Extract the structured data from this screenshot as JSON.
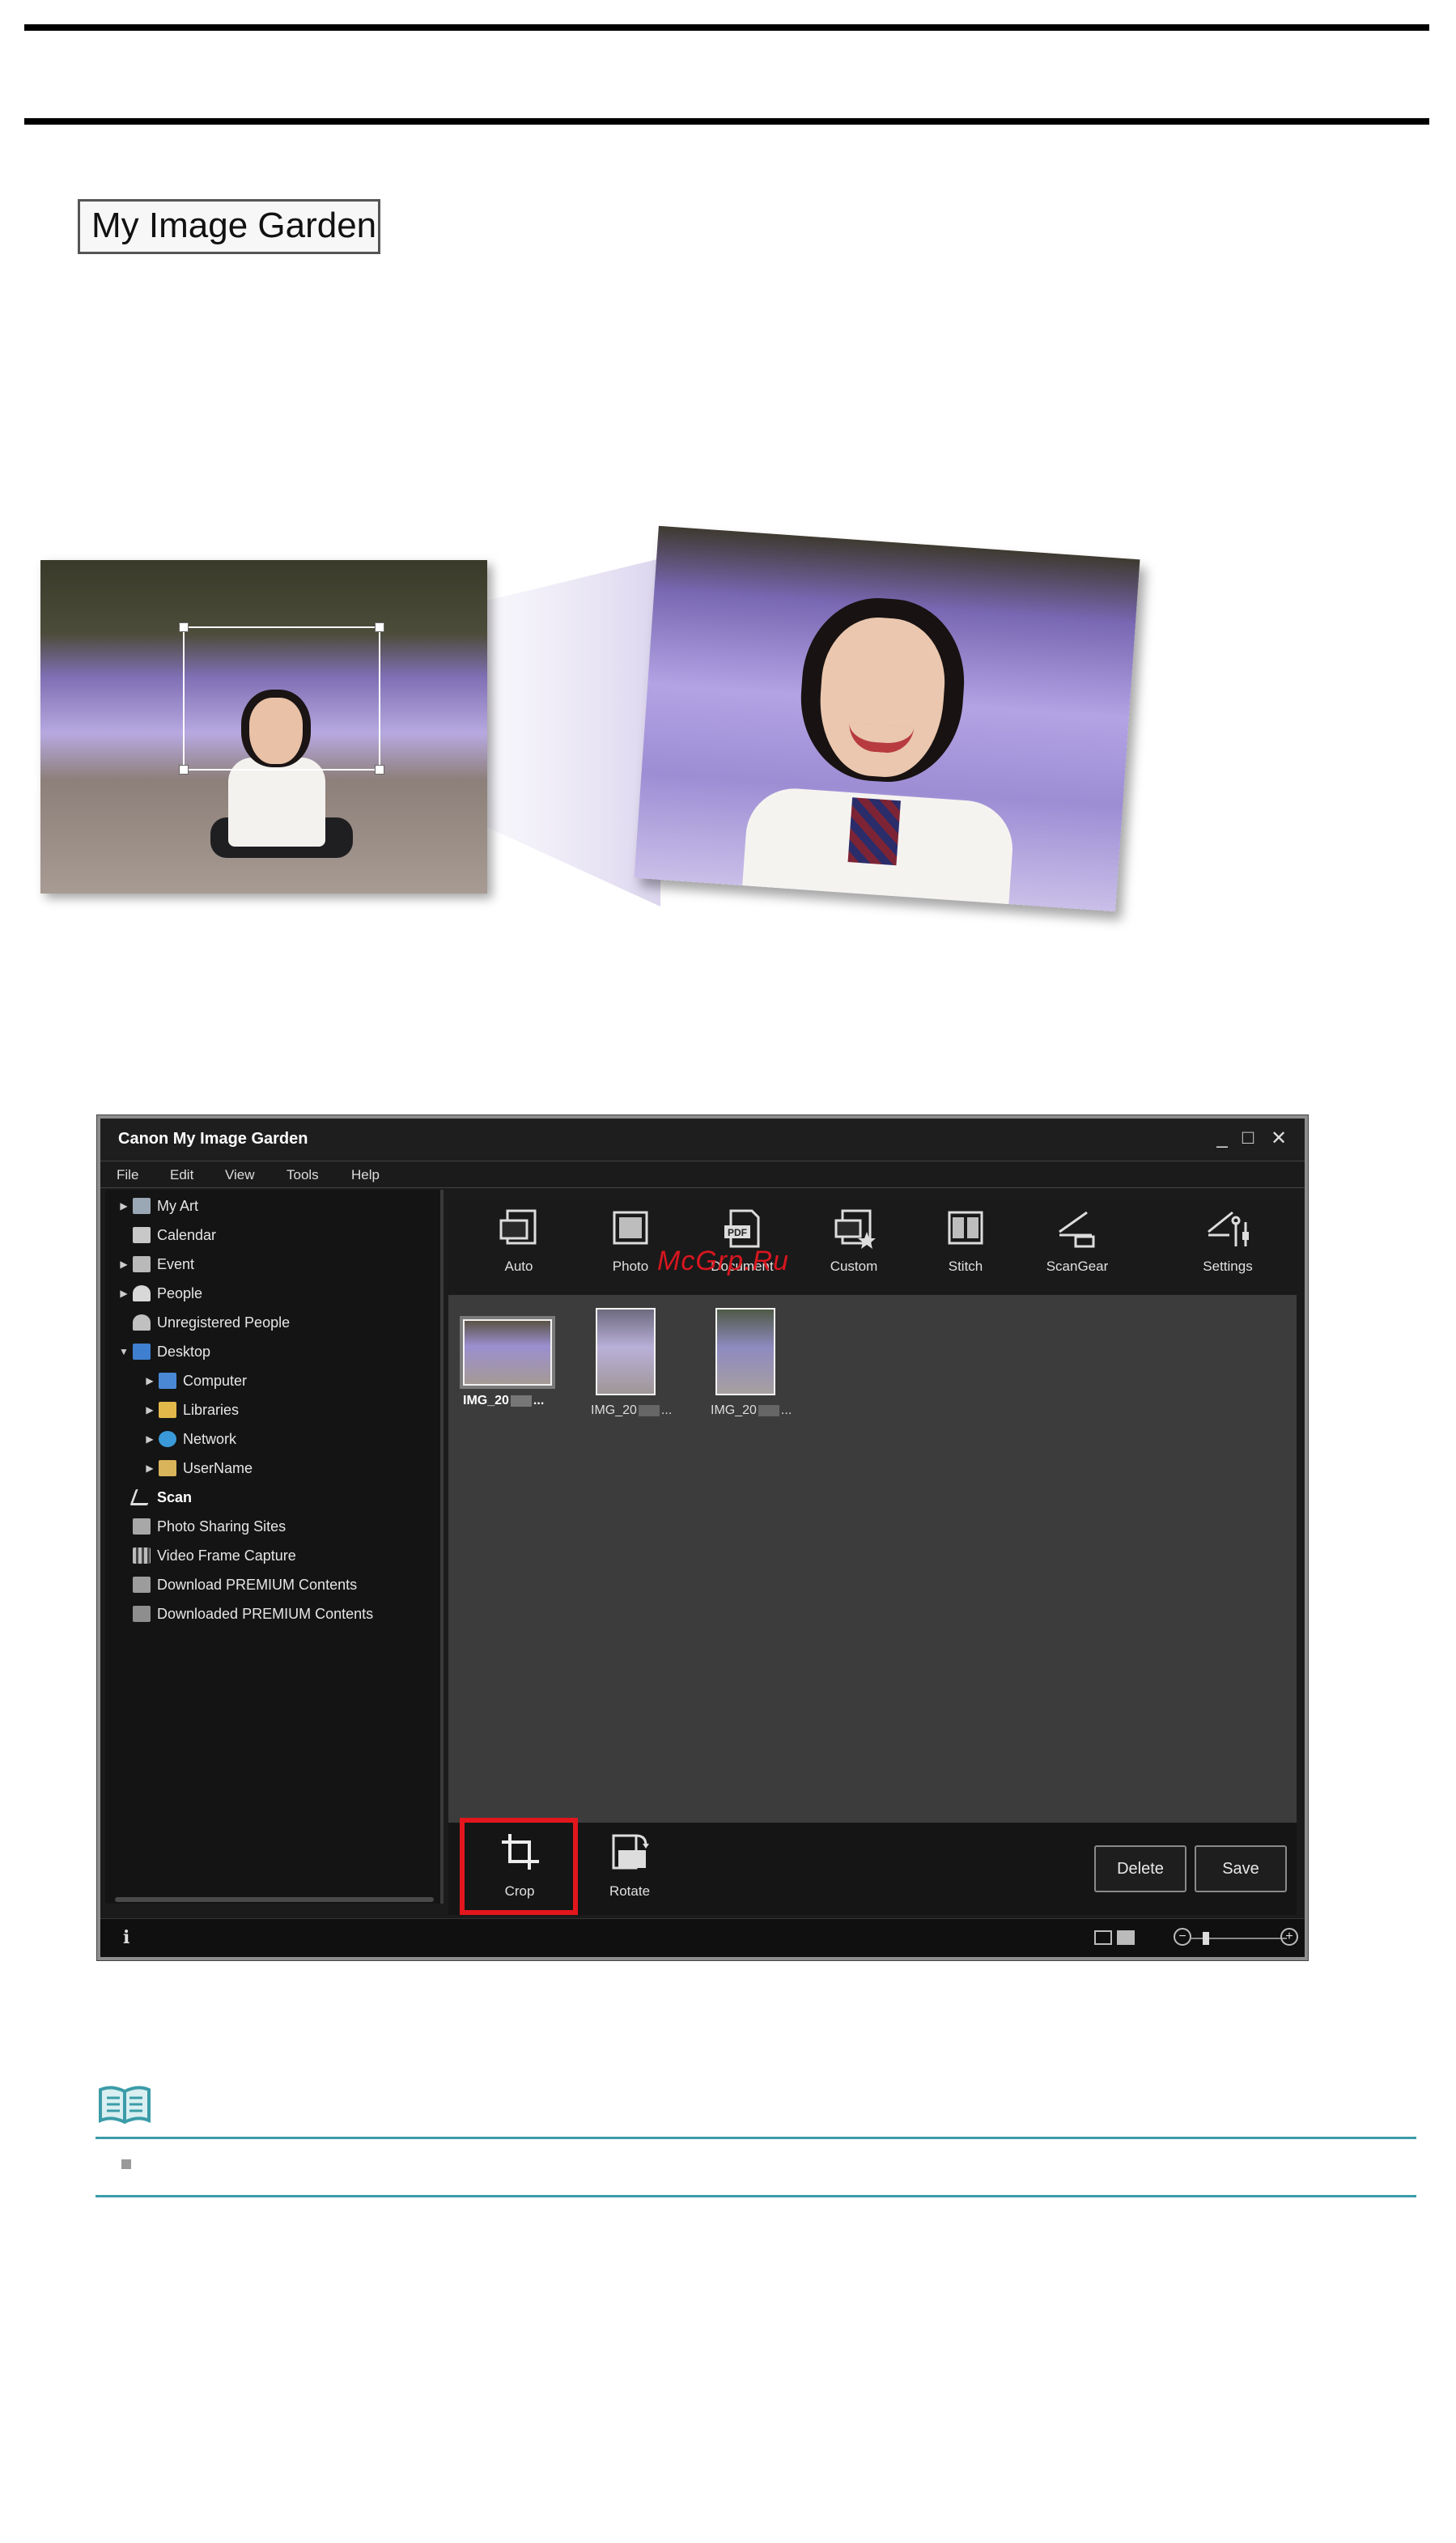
{
  "header": {
    "title_box": "My Image Garden"
  },
  "window": {
    "title": "Canon My Image Garden",
    "controls": {
      "minimize": "_",
      "maximize": "□",
      "close": "✕"
    },
    "menu": [
      "File",
      "Edit",
      "View",
      "Tools",
      "Help"
    ],
    "sidebar": [
      {
        "label": "My Art",
        "icon": "my-art-icon",
        "level": 0,
        "arrow": "▶"
      },
      {
        "label": "Calendar",
        "icon": "calendar-icon",
        "level": 0,
        "arrow": ""
      },
      {
        "label": "Event",
        "icon": "event-icon",
        "level": 0,
        "arrow": "▶"
      },
      {
        "label": "People",
        "icon": "people-icon",
        "level": 0,
        "arrow": "▶"
      },
      {
        "label": "Unregistered People",
        "icon": "unregistered-people-icon",
        "level": 0,
        "arrow": ""
      },
      {
        "label": "Desktop",
        "icon": "desktop-icon",
        "level": 0,
        "arrow": "▼"
      },
      {
        "label": "Computer",
        "icon": "computer-icon",
        "level": 1,
        "arrow": "▶"
      },
      {
        "label": "Libraries",
        "icon": "libraries-icon",
        "level": 1,
        "arrow": "▶"
      },
      {
        "label": "Network",
        "icon": "network-icon",
        "level": 1,
        "arrow": "▶"
      },
      {
        "label": "UserName",
        "icon": "user-folder-icon",
        "level": 1,
        "arrow": "▶"
      },
      {
        "label": "Scan",
        "icon": "scan-icon",
        "level": 0,
        "arrow": "",
        "bold": true
      },
      {
        "label": "Photo Sharing Sites",
        "icon": "photo-sharing-icon",
        "level": 0,
        "arrow": ""
      },
      {
        "label": "Video Frame Capture",
        "icon": "video-frame-icon",
        "level": 0,
        "arrow": ""
      },
      {
        "label": "Download PREMIUM Contents",
        "icon": "download-premium-icon",
        "level": 0,
        "arrow": ""
      },
      {
        "label": "Downloaded PREMIUM Contents",
        "icon": "downloaded-premium-icon",
        "level": 0,
        "arrow": ""
      }
    ],
    "toolbar": [
      {
        "label": "Auto",
        "icon": "auto-scan-icon"
      },
      {
        "label": "Photo",
        "icon": "photo-scan-icon"
      },
      {
        "label": "Document",
        "icon": "pdf-document-icon"
      },
      {
        "label": "Custom",
        "icon": "custom-scan-icon"
      },
      {
        "label": "Stitch",
        "icon": "stitch-icon"
      },
      {
        "label": "ScanGear",
        "icon": "scangear-icon"
      },
      {
        "label": "Settings",
        "icon": "settings-icon"
      }
    ],
    "watermark": "McGrp.Ru",
    "thumbnails": [
      {
        "label": "IMG_20",
        "suffix": "...",
        "selected": true
      },
      {
        "label": "IMG_20",
        "suffix": "...",
        "selected": false
      },
      {
        "label": "IMG_20",
        "suffix": "...",
        "selected": false
      }
    ],
    "bottom_tools": [
      {
        "label": "Crop",
        "icon": "crop-icon"
      },
      {
        "label": "Rotate",
        "icon": "rotate-icon"
      }
    ],
    "buttons": {
      "delete": "Delete",
      "save": "Save"
    },
    "status": {
      "info": "i",
      "zoom_minus": "−",
      "zoom_plus": "+"
    },
    "colors": {
      "highlight": "#e3161d",
      "window_bg": "#1b1b1b",
      "content_bg": "#3c3c3c"
    }
  },
  "note": {
    "icon": "note-book-icon",
    "rule_color": "#3b9ca8"
  }
}
